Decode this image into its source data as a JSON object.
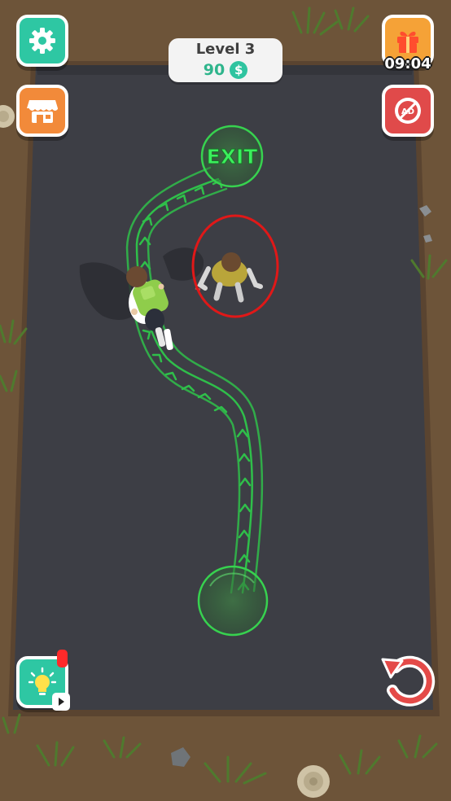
{
  "hud": {
    "level_label": "Level 3",
    "coins": "90",
    "coin_symbol": "$",
    "gift_timer": "09:04",
    "noads_badge": "AD"
  },
  "board": {
    "exit_label": "EXIT"
  },
  "colors": {
    "accent": "#2ec7a3",
    "path": "#2fbf4a",
    "exit_text": "#3af05c",
    "enemy_ring": "#e01818",
    "floor": "#3d3e45"
  },
  "icons": {
    "settings": "gear-icon",
    "shop": "shop-icon",
    "gift": "gift-icon",
    "noads": "no-ads-icon",
    "hint": "lightbulb-icon",
    "undo": "undo-icon"
  }
}
